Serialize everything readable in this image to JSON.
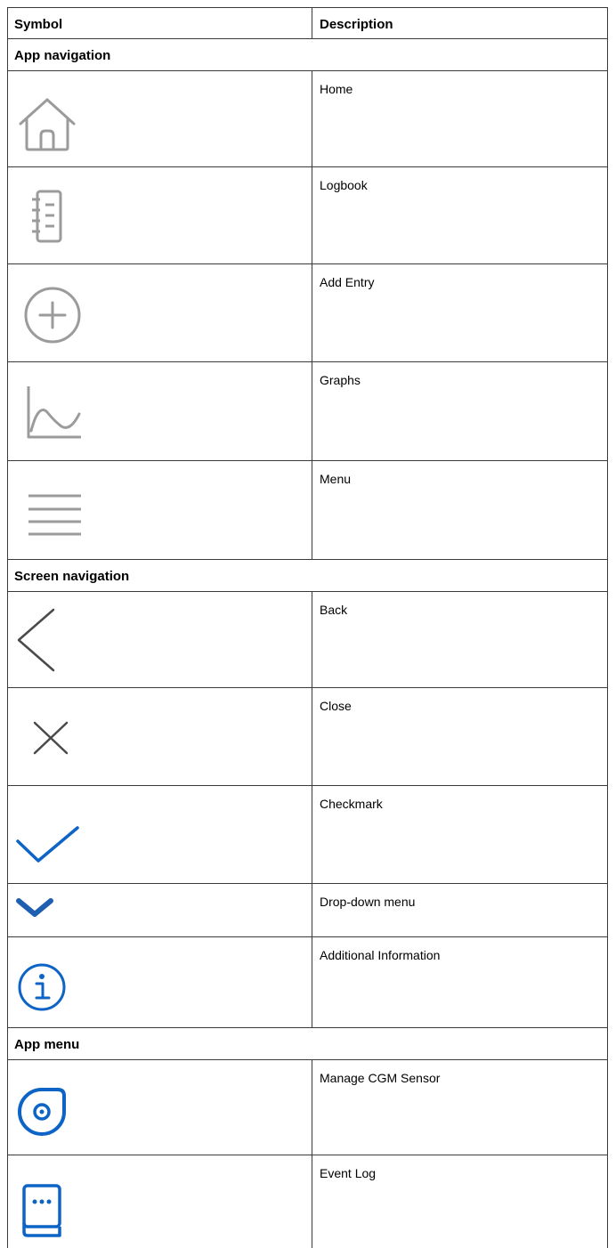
{
  "header": {
    "symbol": "Symbol",
    "description": "Description"
  },
  "sections": [
    {
      "title": "App navigation",
      "items": [
        {
          "icon": "home-icon",
          "label": "Home"
        },
        {
          "icon": "logbook-icon",
          "label": "Logbook"
        },
        {
          "icon": "add-entry-icon",
          "label": "Add Entry"
        },
        {
          "icon": "graphs-icon",
          "label": "Graphs"
        },
        {
          "icon": "menu-icon",
          "label": "Menu"
        }
      ]
    },
    {
      "title": "Screen navigation",
      "items": [
        {
          "icon": "back-icon",
          "label": "Back"
        },
        {
          "icon": "close-icon",
          "label": "Close"
        },
        {
          "icon": "checkmark-icon",
          "label": "Checkmark"
        },
        {
          "icon": "chevron-down-icon",
          "label": "Drop-down menu"
        },
        {
          "icon": "info-icon",
          "label": "Additional Information"
        }
      ]
    },
    {
      "title": "App menu",
      "items": [
        {
          "icon": "cgm-sensor-icon",
          "label": "Manage CGM Sensor"
        },
        {
          "icon": "event-log-icon",
          "label": "Event Log"
        }
      ]
    }
  ],
  "colors": {
    "gray_icon": "#9b9b9b",
    "dark_icon": "#4a4a4a",
    "blue_icon": "#0d63c6",
    "border": "#3a3a3a"
  }
}
